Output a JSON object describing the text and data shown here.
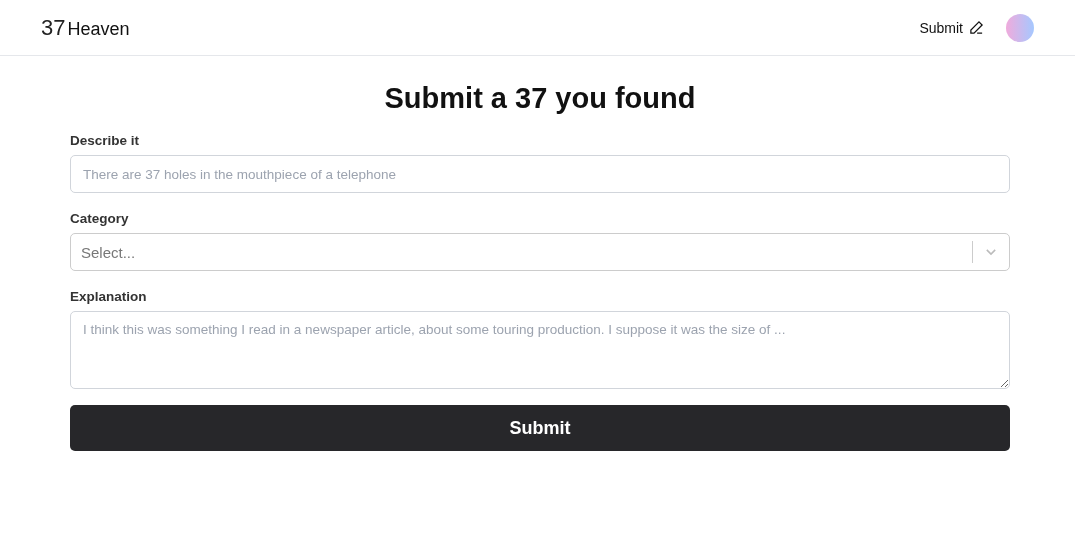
{
  "header": {
    "logo_number": "37",
    "logo_text": "Heaven",
    "submit_link": "Submit"
  },
  "title": "Submit a 37 you found",
  "fields": [
    {
      "kind": "input",
      "label": "Describe it",
      "placeholder": "There are 37 holes in the mouthpiece of a telephone"
    },
    {
      "kind": "select",
      "label": "Category",
      "placeholder": "Select..."
    },
    {
      "kind": "textarea",
      "label": "Explanation",
      "placeholder": "I think this was something I read in a newspaper article, about some touring production. I suppose it was the size of ..."
    }
  ],
  "submit_button": "Submit"
}
